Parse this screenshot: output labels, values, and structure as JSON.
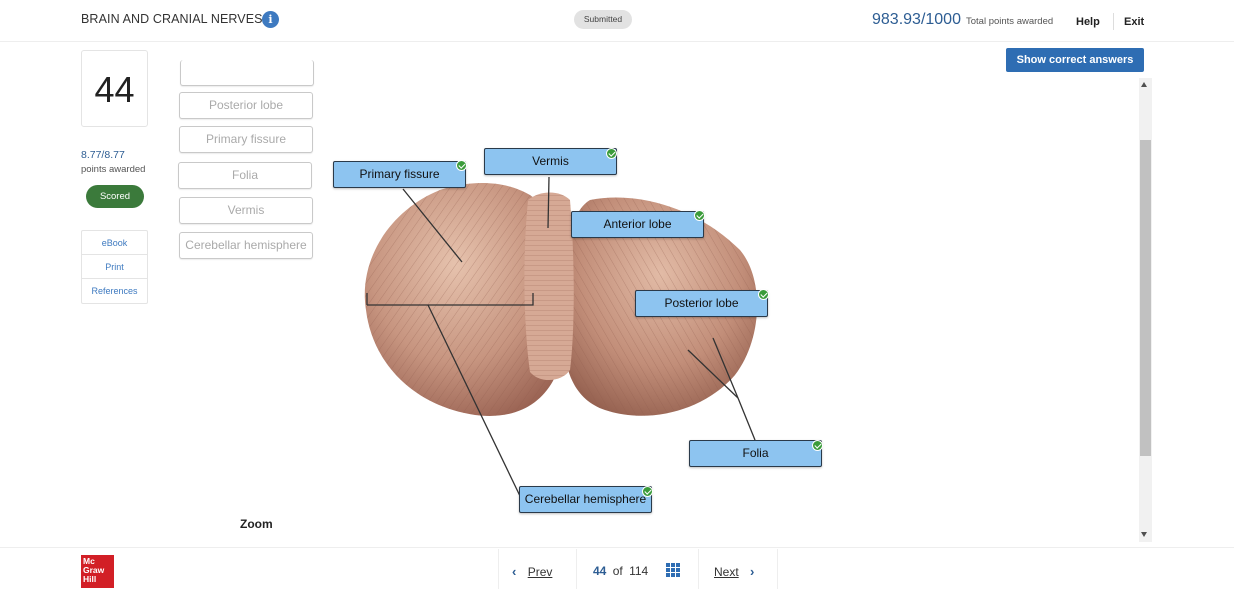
{
  "header": {
    "title": "BRAIN AND CRANIAL NERVES",
    "info_icon": "info-icon",
    "status": "Submitted",
    "score": "983.93/1000",
    "score_label": "Total points awarded",
    "help": "Help",
    "exit": "Exit"
  },
  "question": {
    "number": "44",
    "points": "8.77/8.77",
    "points_label": "points awarded",
    "badge": "Scored"
  },
  "tools": [
    "eBook",
    "Print",
    "References"
  ],
  "bank": [
    "Posterior lobe",
    "Primary fissure",
    "Folia",
    "Vermis",
    "Cerebellar hemisphere"
  ],
  "show_correct": "Show correct answers",
  "labels": {
    "primary_fissure": "Primary fissure",
    "vermis": "Vermis",
    "anterior_lobe": "Anterior lobe",
    "posterior_lobe": "Posterior lobe",
    "folia": "Folia",
    "cerebellar_hemisphere": "Cerebellar hemisphere"
  },
  "zoom": "Zoom",
  "footer": {
    "logo": [
      "Mc",
      "Graw",
      "Hill"
    ],
    "prev": "Prev",
    "current": "44",
    "of": "of",
    "total": "114",
    "next": "Next"
  },
  "colors": {
    "accent": "#2e6db3",
    "label_fill": "#8dc4f0",
    "scored": "#3b7a3b",
    "logo": "#d21f26"
  }
}
